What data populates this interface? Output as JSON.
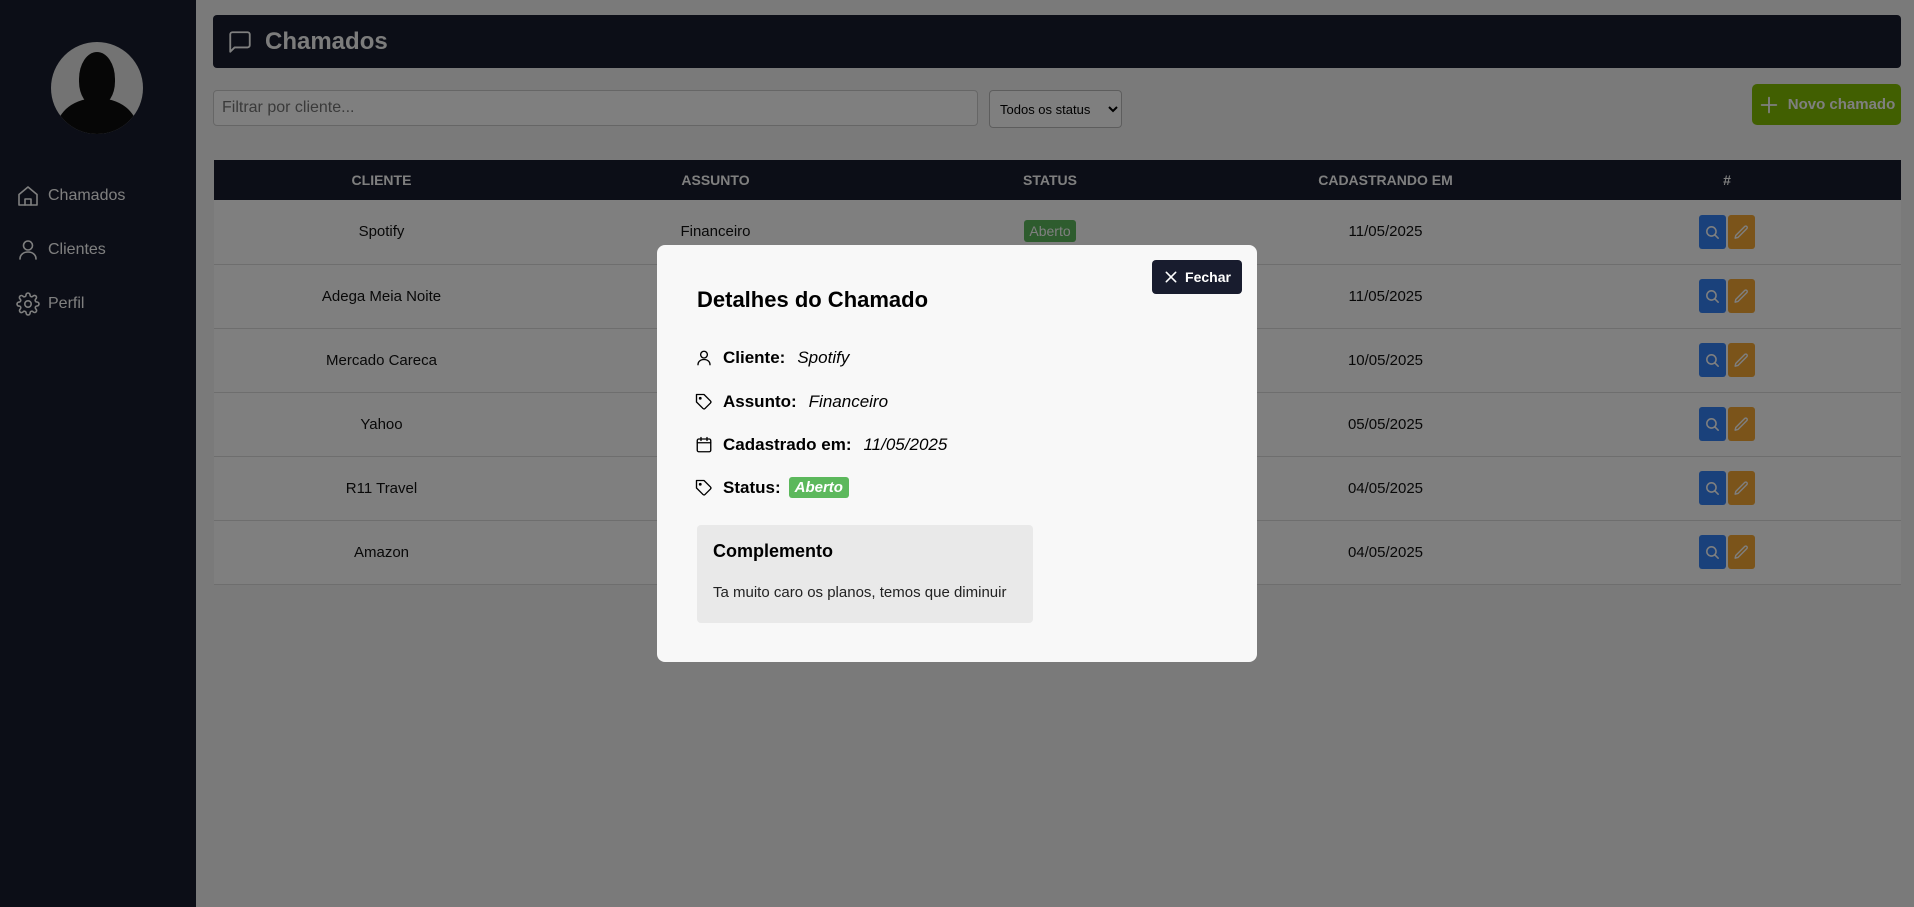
{
  "sidebar": {
    "items": [
      {
        "label": "Chamados",
        "icon": "home-icon"
      },
      {
        "label": "Clientes",
        "icon": "user-icon"
      },
      {
        "label": "Perfil",
        "icon": "gear-icon"
      }
    ]
  },
  "header": {
    "title": "Chamados",
    "icon": "message-square-icon"
  },
  "filters": {
    "client_placeholder": "Filtrar por cliente...",
    "status_selected": "Todos os status"
  },
  "new_button": {
    "label": "Novo chamado",
    "icon": "plus-icon"
  },
  "table": {
    "columns": [
      "Cliente",
      "Assunto",
      "Status",
      "Cadastrando em",
      "#"
    ],
    "rows": [
      {
        "cliente": "Spotify",
        "assunto": "Financeiro",
        "status": "Aberto",
        "data": "11/05/2025"
      },
      {
        "cliente": "Adega Meia Noite",
        "assunto": "",
        "status": "",
        "data": "11/05/2025"
      },
      {
        "cliente": "Mercado Careca",
        "assunto": "",
        "status": "",
        "data": "10/05/2025"
      },
      {
        "cliente": "Yahoo",
        "assunto": "",
        "status": "",
        "data": "05/05/2025"
      },
      {
        "cliente": "R11 Travel",
        "assunto": "",
        "status": "",
        "data": "04/05/2025"
      },
      {
        "cliente": "Amazon",
        "assunto": "",
        "status": "",
        "data": "04/05/2025"
      }
    ]
  },
  "modal": {
    "title": "Detalhes do Chamado",
    "close_label": "Fechar",
    "cliente_label": "Cliente:",
    "cliente_value": "Spotify",
    "assunto_label": "Assunto:",
    "assunto_value": "Financeiro",
    "cadastrado_label": "Cadastrado em:",
    "cadastrado_value": "11/05/2025",
    "status_label": "Status:",
    "status_value": "Aberto",
    "complemento_title": "Complemento",
    "complemento_text": "Ta muito caro os planos, temos que diminuir"
  },
  "colors": {
    "dark": "#181c2e",
    "green_button": "#83bf02",
    "status_open": "#5cb85c",
    "search_action": "#3583f6",
    "edit_action": "#f6a935"
  }
}
